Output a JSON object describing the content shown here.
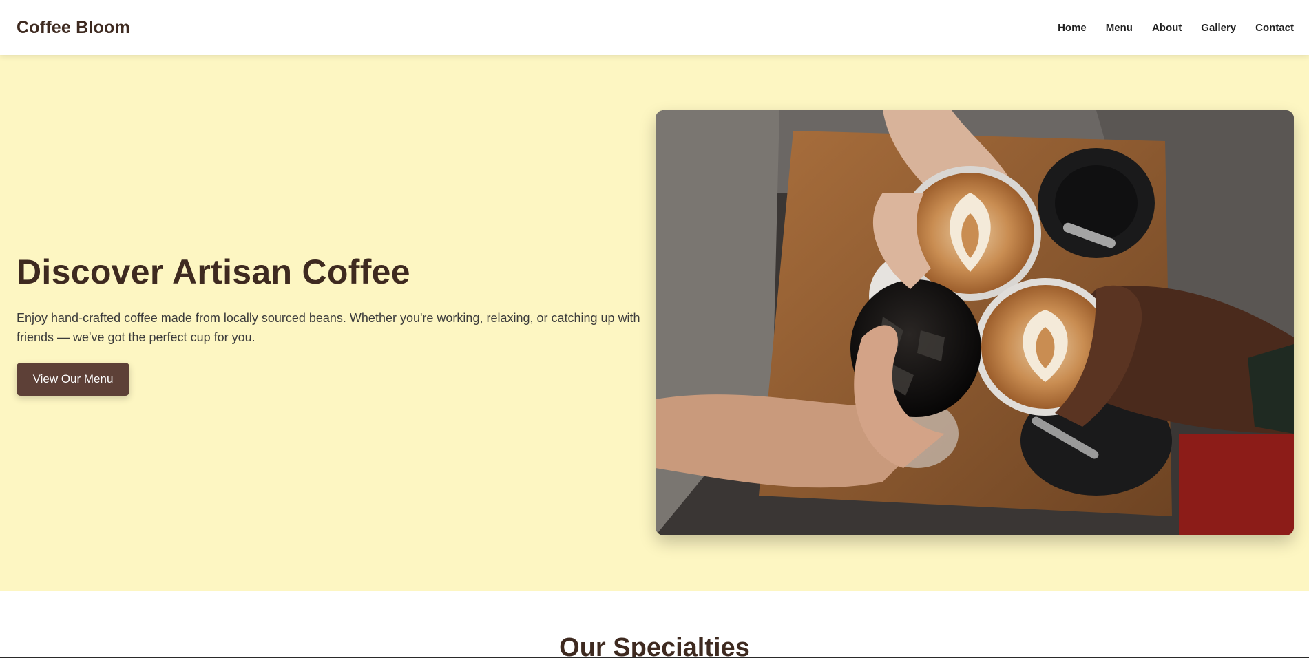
{
  "header": {
    "brand": "Coffee Bloom",
    "nav": [
      "Home",
      "Menu",
      "About",
      "Gallery",
      "Contact"
    ]
  },
  "hero": {
    "title": "Discover Artisan Coffee",
    "text": "Enjoy hand-crafted coffee made from locally sourced beans. Whether you're working, relaxing, or catching up with friends — we've got the perfect cup for you.",
    "button": "View Our Menu"
  },
  "specialties": {
    "title": "Our Specialties"
  },
  "colors": {
    "hero_bg": "#fdf6c2",
    "button_bg": "#5d4037",
    "brand_text": "#3e2a20"
  }
}
